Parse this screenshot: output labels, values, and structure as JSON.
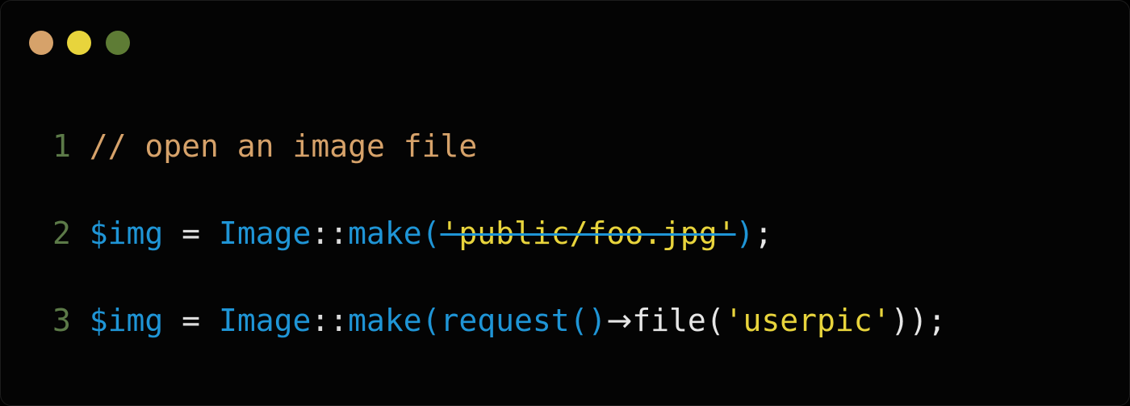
{
  "colors": {
    "background": "#040404",
    "dot_red": "#d6a26a",
    "dot_yellow": "#e8d43c",
    "dot_green": "#5e7c35",
    "line_number": "#5c7a48",
    "comment": "#d6a26a",
    "variable": "#1f95d6",
    "operator": "#dcdcdc",
    "function": "#1f95d6",
    "string": "#e8d43c",
    "plain": "#e6e6e6"
  },
  "lines": [
    {
      "number": "1",
      "tokens": [
        {
          "text": "// open an image file",
          "kind": "comment"
        }
      ]
    },
    {
      "number": "2",
      "tokens": [
        {
          "text": "$img",
          "kind": "variable"
        },
        {
          "text": " = ",
          "kind": "operator"
        },
        {
          "text": "Image",
          "kind": "function"
        },
        {
          "text": "::",
          "kind": "operator"
        },
        {
          "text": "make",
          "kind": "function"
        },
        {
          "text": "(",
          "kind": "function"
        },
        {
          "text": "'public/foo.jpg'",
          "kind": "string_struck"
        },
        {
          "text": ")",
          "kind": "function"
        },
        {
          "text": ";",
          "kind": "plain"
        }
      ]
    },
    {
      "number": "3",
      "tokens": [
        {
          "text": "$img",
          "kind": "variable"
        },
        {
          "text": " = ",
          "kind": "operator"
        },
        {
          "text": "Image",
          "kind": "function"
        },
        {
          "text": "::",
          "kind": "operator"
        },
        {
          "text": "make",
          "kind": "function"
        },
        {
          "text": "(",
          "kind": "function"
        },
        {
          "text": "request",
          "kind": "function"
        },
        {
          "text": "()",
          "kind": "function"
        },
        {
          "text": "→",
          "kind": "arrow"
        },
        {
          "text": "file(",
          "kind": "plain"
        },
        {
          "text": "'userpic'",
          "kind": "string"
        },
        {
          "text": "));",
          "kind": "plain"
        }
      ]
    }
  ]
}
